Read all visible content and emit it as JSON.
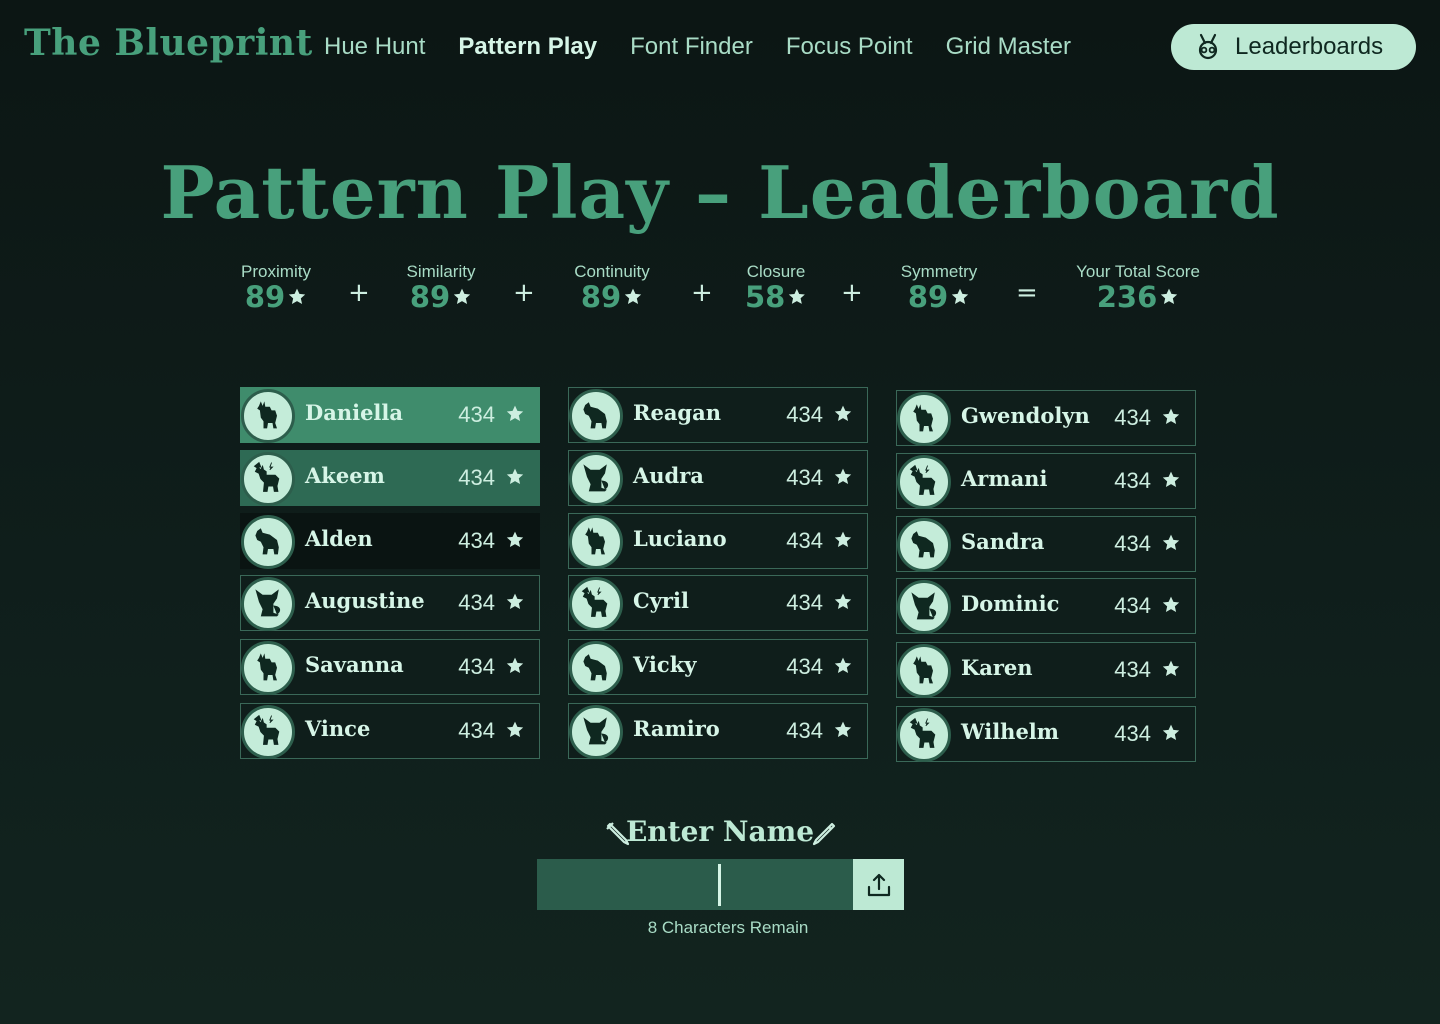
{
  "nav": {
    "brand": "The Blueprint",
    "links": [
      "Hue Hunt",
      "Pattern Play",
      "Font Finder",
      "Focus Point",
      "Grid Master"
    ],
    "active_index": 1,
    "leaderboards_label": "Leaderboards"
  },
  "page": {
    "title": "Pattern Play – Leaderboard"
  },
  "scores": [
    {
      "label": "Proximity",
      "value": "89"
    },
    {
      "label": "Similarity",
      "value": "89"
    },
    {
      "label": "Continuity",
      "value": "89"
    },
    {
      "label": "Closure",
      "value": "58"
    },
    {
      "label": "Symmetry",
      "value": "89"
    },
    {
      "label": "Your Total Score",
      "value": "236"
    }
  ],
  "operators": [
    "+",
    "+",
    "+",
    "+",
    "="
  ],
  "leaderboard": [
    {
      "name": "Daniella",
      "score": "434",
      "animal": "giraffe"
    },
    {
      "name": "Akeem",
      "score": "434",
      "animal": "deer"
    },
    {
      "name": "Alden",
      "score": "434",
      "animal": "bear"
    },
    {
      "name": "Augustine",
      "score": "434",
      "animal": "fox"
    },
    {
      "name": "Savanna",
      "score": "434",
      "animal": "giraffe"
    },
    {
      "name": "Vince",
      "score": "434",
      "animal": "deer"
    },
    {
      "name": "Reagan",
      "score": "434",
      "animal": "bear"
    },
    {
      "name": "Audra",
      "score": "434",
      "animal": "fox"
    },
    {
      "name": "Luciano",
      "score": "434",
      "animal": "giraffe"
    },
    {
      "name": "Cyril",
      "score": "434",
      "animal": "deer"
    },
    {
      "name": "Vicky",
      "score": "434",
      "animal": "bear"
    },
    {
      "name": "Ramiro",
      "score": "434",
      "animal": "fox"
    },
    {
      "name": "Gwendolyn",
      "score": "434",
      "animal": "giraffe"
    },
    {
      "name": "Armani",
      "score": "434",
      "animal": "deer"
    },
    {
      "name": "Sandra",
      "score": "434",
      "animal": "bear"
    },
    {
      "name": "Dominic",
      "score": "434",
      "animal": "fox"
    },
    {
      "name": "Karen",
      "score": "434",
      "animal": "giraffe"
    },
    {
      "name": "Wilhelm",
      "score": "434",
      "animal": "deer"
    }
  ],
  "entry": {
    "heading": "Enter Name",
    "value": "",
    "remaining_text": "8 Characters Remain"
  },
  "colors": {
    "accent": "#48a07c",
    "rank1": "#3f8c6c",
    "rank2": "#2e6a54",
    "button_bg": "#bde9d4"
  }
}
